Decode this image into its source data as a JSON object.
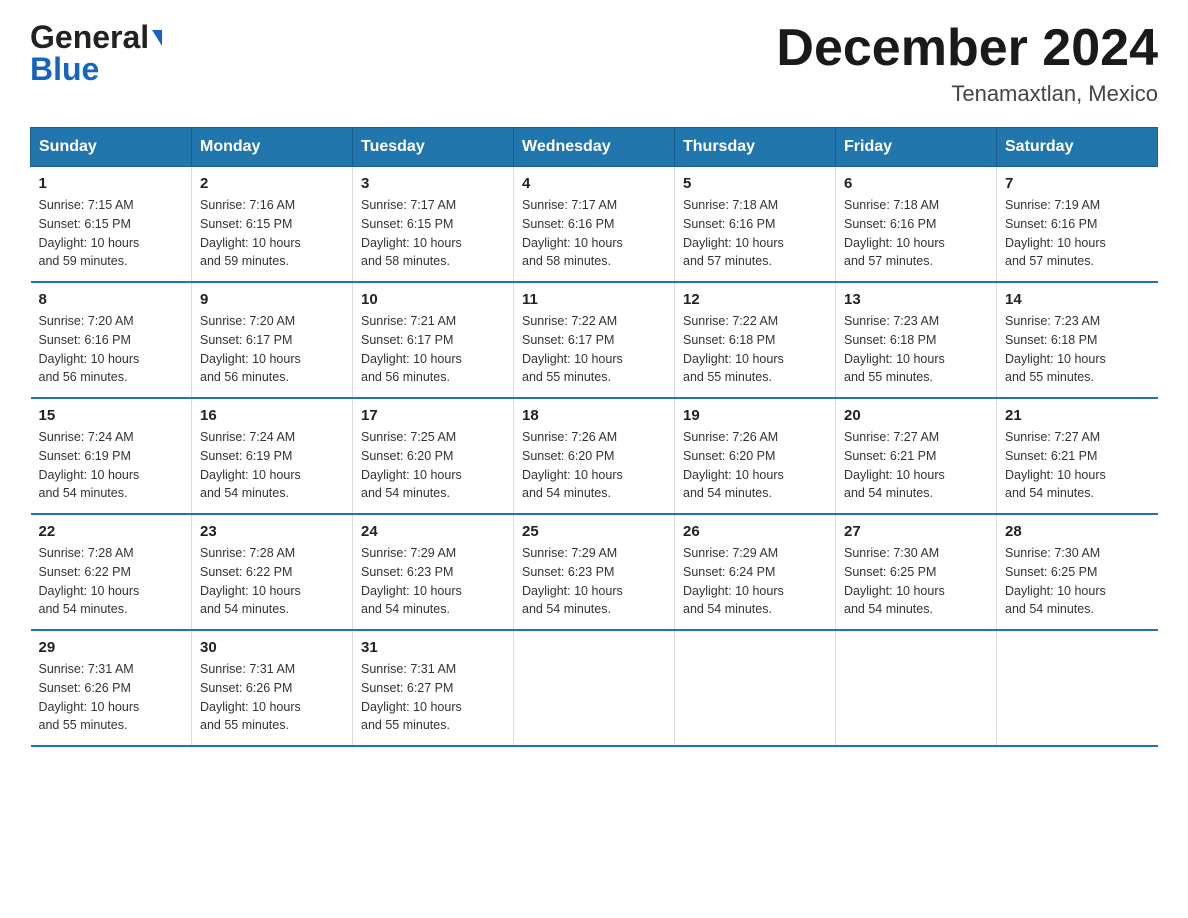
{
  "header": {
    "logo_general": "General",
    "logo_blue": "Blue",
    "month_title": "December 2024",
    "location": "Tenamaxtlan, Mexico"
  },
  "weekdays": [
    "Sunday",
    "Monday",
    "Tuesday",
    "Wednesday",
    "Thursday",
    "Friday",
    "Saturday"
  ],
  "weeks": [
    [
      {
        "day": "1",
        "sunrise": "7:15 AM",
        "sunset": "6:15 PM",
        "daylight": "10 hours and 59 minutes."
      },
      {
        "day": "2",
        "sunrise": "7:16 AM",
        "sunset": "6:15 PM",
        "daylight": "10 hours and 59 minutes."
      },
      {
        "day": "3",
        "sunrise": "7:17 AM",
        "sunset": "6:15 PM",
        "daylight": "10 hours and 58 minutes."
      },
      {
        "day": "4",
        "sunrise": "7:17 AM",
        "sunset": "6:16 PM",
        "daylight": "10 hours and 58 minutes."
      },
      {
        "day": "5",
        "sunrise": "7:18 AM",
        "sunset": "6:16 PM",
        "daylight": "10 hours and 57 minutes."
      },
      {
        "day": "6",
        "sunrise": "7:18 AM",
        "sunset": "6:16 PM",
        "daylight": "10 hours and 57 minutes."
      },
      {
        "day": "7",
        "sunrise": "7:19 AM",
        "sunset": "6:16 PM",
        "daylight": "10 hours and 57 minutes."
      }
    ],
    [
      {
        "day": "8",
        "sunrise": "7:20 AM",
        "sunset": "6:16 PM",
        "daylight": "10 hours and 56 minutes."
      },
      {
        "day": "9",
        "sunrise": "7:20 AM",
        "sunset": "6:17 PM",
        "daylight": "10 hours and 56 minutes."
      },
      {
        "day": "10",
        "sunrise": "7:21 AM",
        "sunset": "6:17 PM",
        "daylight": "10 hours and 56 minutes."
      },
      {
        "day": "11",
        "sunrise": "7:22 AM",
        "sunset": "6:17 PM",
        "daylight": "10 hours and 55 minutes."
      },
      {
        "day": "12",
        "sunrise": "7:22 AM",
        "sunset": "6:18 PM",
        "daylight": "10 hours and 55 minutes."
      },
      {
        "day": "13",
        "sunrise": "7:23 AM",
        "sunset": "6:18 PM",
        "daylight": "10 hours and 55 minutes."
      },
      {
        "day": "14",
        "sunrise": "7:23 AM",
        "sunset": "6:18 PM",
        "daylight": "10 hours and 55 minutes."
      }
    ],
    [
      {
        "day": "15",
        "sunrise": "7:24 AM",
        "sunset": "6:19 PM",
        "daylight": "10 hours and 54 minutes."
      },
      {
        "day": "16",
        "sunrise": "7:24 AM",
        "sunset": "6:19 PM",
        "daylight": "10 hours and 54 minutes."
      },
      {
        "day": "17",
        "sunrise": "7:25 AM",
        "sunset": "6:20 PM",
        "daylight": "10 hours and 54 minutes."
      },
      {
        "day": "18",
        "sunrise": "7:26 AM",
        "sunset": "6:20 PM",
        "daylight": "10 hours and 54 minutes."
      },
      {
        "day": "19",
        "sunrise": "7:26 AM",
        "sunset": "6:20 PM",
        "daylight": "10 hours and 54 minutes."
      },
      {
        "day": "20",
        "sunrise": "7:27 AM",
        "sunset": "6:21 PM",
        "daylight": "10 hours and 54 minutes."
      },
      {
        "day": "21",
        "sunrise": "7:27 AM",
        "sunset": "6:21 PM",
        "daylight": "10 hours and 54 minutes."
      }
    ],
    [
      {
        "day": "22",
        "sunrise": "7:28 AM",
        "sunset": "6:22 PM",
        "daylight": "10 hours and 54 minutes."
      },
      {
        "day": "23",
        "sunrise": "7:28 AM",
        "sunset": "6:22 PM",
        "daylight": "10 hours and 54 minutes."
      },
      {
        "day": "24",
        "sunrise": "7:29 AM",
        "sunset": "6:23 PM",
        "daylight": "10 hours and 54 minutes."
      },
      {
        "day": "25",
        "sunrise": "7:29 AM",
        "sunset": "6:23 PM",
        "daylight": "10 hours and 54 minutes."
      },
      {
        "day": "26",
        "sunrise": "7:29 AM",
        "sunset": "6:24 PM",
        "daylight": "10 hours and 54 minutes."
      },
      {
        "day": "27",
        "sunrise": "7:30 AM",
        "sunset": "6:25 PM",
        "daylight": "10 hours and 54 minutes."
      },
      {
        "day": "28",
        "sunrise": "7:30 AM",
        "sunset": "6:25 PM",
        "daylight": "10 hours and 54 minutes."
      }
    ],
    [
      {
        "day": "29",
        "sunrise": "7:31 AM",
        "sunset": "6:26 PM",
        "daylight": "10 hours and 55 minutes."
      },
      {
        "day": "30",
        "sunrise": "7:31 AM",
        "sunset": "6:26 PM",
        "daylight": "10 hours and 55 minutes."
      },
      {
        "day": "31",
        "sunrise": "7:31 AM",
        "sunset": "6:27 PM",
        "daylight": "10 hours and 55 minutes."
      },
      null,
      null,
      null,
      null
    ]
  ],
  "labels": {
    "sunrise": "Sunrise:",
    "sunset": "Sunset:",
    "daylight": "Daylight:"
  }
}
